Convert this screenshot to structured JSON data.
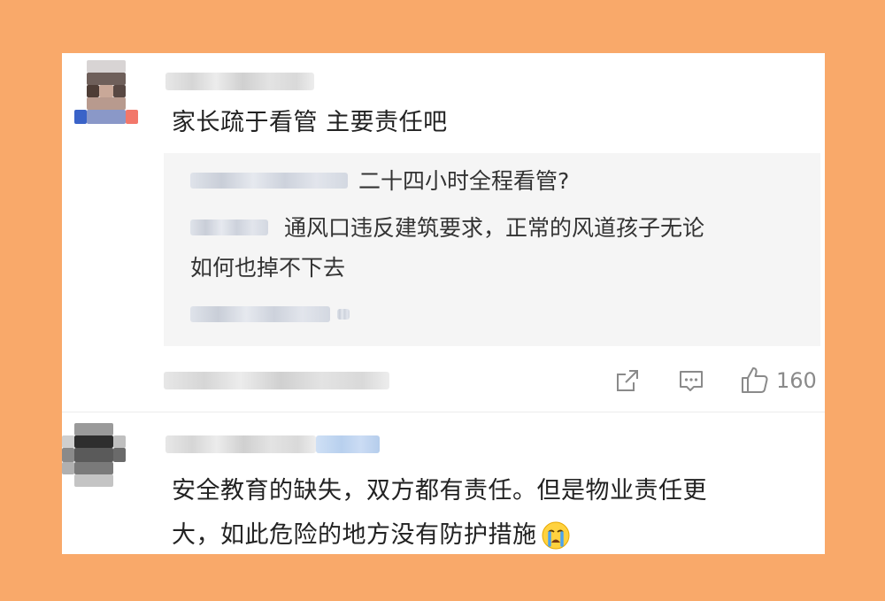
{
  "comments": [
    {
      "text": "家长疏于看管 主要责任吧",
      "reply": {
        "line1": "二十四小时全程看管?",
        "line2": "通风口违反建筑要求，正常的风道孩子无论",
        "line3": "如何也掉不下去"
      },
      "actions": {
        "share_icon": "share-icon",
        "comment_icon": "comment-icon",
        "like_icon": "thumbs-up-icon",
        "like_count": "160"
      }
    },
    {
      "text_line1": "安全教育的缺失，双方都有责任。但是物业责任更",
      "text_line2": "大，如此危险的地方没有防护措施",
      "emoji": "crying-face-emoji"
    }
  ],
  "colors": {
    "background": "#F9A96A",
    "card": "#ffffff",
    "reply_bg": "#f5f5f5",
    "text": "#222222",
    "meta": "#8a8a8a"
  }
}
